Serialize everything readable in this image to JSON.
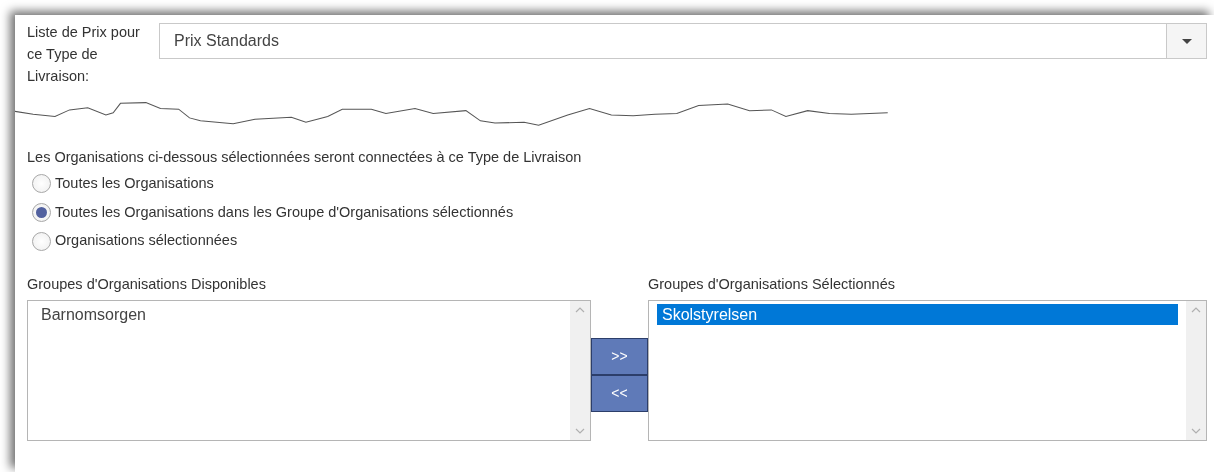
{
  "price_list": {
    "label": "Liste de Prix pour ce Type de Livraison:",
    "value": "Prix Standards"
  },
  "organisations": {
    "heading": "Les Organisations ci-dessous sélectionnées seront connectées à ce Type de Livraison",
    "options": [
      {
        "label": "Toutes les Organisations",
        "selected": false
      },
      {
        "label": "Toutes les Organisations dans les Groupe d'Organisations sélectionnés",
        "selected": true
      },
      {
        "label": "Organisations sélectionnées",
        "selected": false
      }
    ]
  },
  "available_groups": {
    "label": "Groupes d'Organisations Disponibles",
    "items": [
      {
        "text": "Barnomsorgen",
        "selected": false
      }
    ]
  },
  "transfer_buttons": [
    ">>",
    "<<"
  ],
  "selected_groups": {
    "label": "Groupes d'Organisations Sélectionnés",
    "items": [
      {
        "text": "Skolstyrelsen",
        "selected": true
      }
    ]
  }
}
